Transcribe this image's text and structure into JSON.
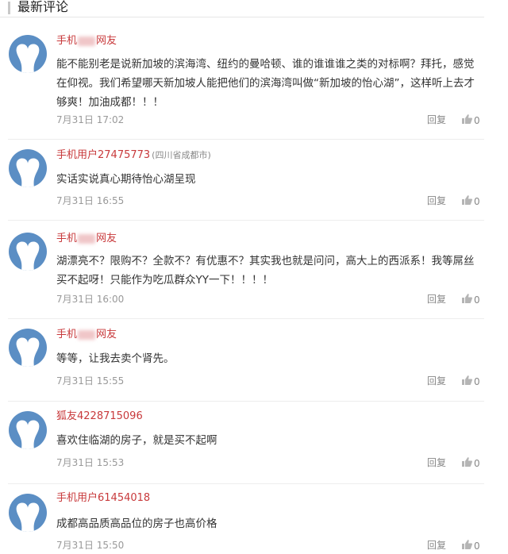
{
  "section": {
    "title": "最新评论"
  },
  "actions": {
    "reply_label": "回复"
  },
  "comments": [
    {
      "user_prefix": "手机",
      "user_suffix": "网友",
      "location": "",
      "content": "能不能别老是说新加坡的滨海湾、纽约的曼哈顿、谁的谁谁谁之类的对标啊？拜托，感觉在仰视。我们希望哪天新加坡人能把他们的滨海湾叫做“新加坡的怡心湖”，这样听上去才够爽！加油成都！！！",
      "time": "7月31日 17:02",
      "likes": "0"
    },
    {
      "user_prefix": "手机用户27475773",
      "user_suffix": "",
      "location": "(四川省成都市)",
      "content": "实话实说真心期待怡心湖呈现",
      "time": "7月31日 16:55",
      "likes": "0"
    },
    {
      "user_prefix": "手机",
      "user_suffix": "网友",
      "location": "",
      "content": "湖漂亮不？限购不？全款不？有优惠不？其实我也就是问问，高大上的西派系！我等屌丝买不起呀！只能作为吃瓜群众YY一下！！！！",
      "time": "7月31日 16:00",
      "likes": "0"
    },
    {
      "user_prefix": "手机",
      "user_suffix": "网友",
      "location": "",
      "content": "等等，让我去卖个肾先。",
      "time": "7月31日 15:55",
      "likes": "0"
    },
    {
      "user_prefix": "狐友4228715096",
      "user_suffix": "",
      "location": "",
      "content": "喜欢住临湖的房子，就是买不起啊",
      "time": "7月31日 15:53",
      "likes": "0"
    },
    {
      "user_prefix": "手机用户61454018",
      "user_suffix": "",
      "location": "",
      "content": "成都高品质高品位的房子也高价格",
      "time": "7月31日 15:50",
      "likes": "0"
    }
  ],
  "colors": {
    "username": "#c8393b",
    "avatar_bg": "#5b8ec4",
    "meta": "#999999"
  },
  "icons": {
    "avatar": "default-avatar-icon",
    "like": "thumbs-up-icon"
  }
}
